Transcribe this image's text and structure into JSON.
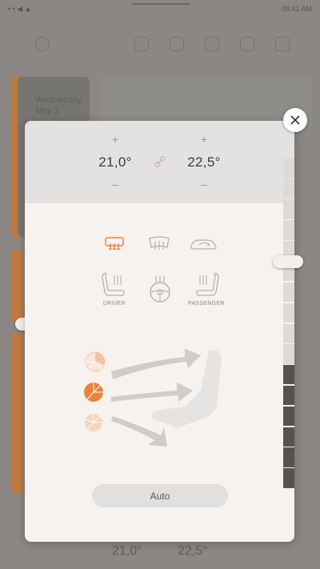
{
  "background": {
    "status_left": "• • ◀ ▲",
    "status_right": "09:41 AM",
    "date_line1": "Wednesday",
    "date_line2": "May 2",
    "bottom_left_temp": "21,0°",
    "bottom_right_temp": "22,5°"
  },
  "climate": {
    "left_zone": {
      "plus": "+",
      "temperature": "21,0°",
      "minus": "–"
    },
    "right_zone": {
      "plus": "+",
      "temperature": "22,5°",
      "minus": "–"
    },
    "left_fan_level": 0.62,
    "right_fan_level": 0.36,
    "defrost_buttons": [
      {
        "icon": "rear-defrost-icon",
        "active": true
      },
      {
        "icon": "windshield-defrost-icon",
        "active": false
      },
      {
        "icon": "recirculation-icon",
        "active": false
      }
    ],
    "seat_buttons": [
      {
        "icon": "driver-seat-heat-icon",
        "label": "DRIVER"
      },
      {
        "icon": "steering-wheel-heat-icon",
        "label": ""
      },
      {
        "icon": "passenger-seat-heat-icon",
        "label": "PASSENGER"
      }
    ],
    "airflow": {
      "upper": "partial",
      "middle": "active",
      "lower": "inactive"
    },
    "auto_label": "Auto"
  },
  "colors": {
    "accent": "#e8833a",
    "accent_light": "#f2c3a0",
    "segment_on": "#555250",
    "segment_off": "#dddbd9"
  }
}
